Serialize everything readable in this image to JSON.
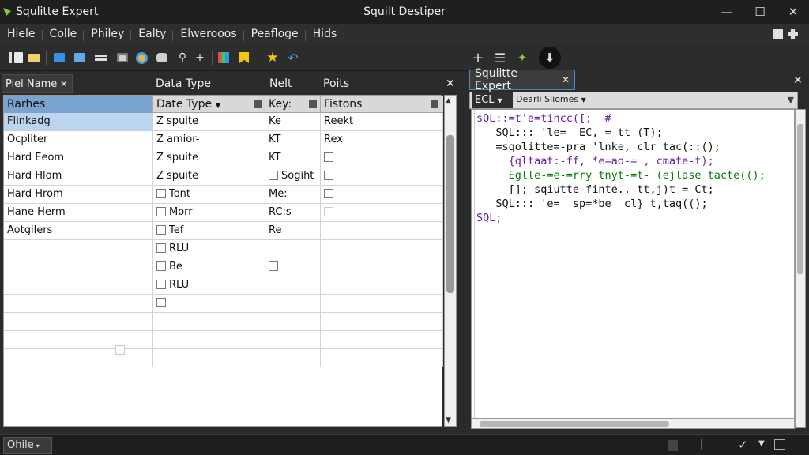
{
  "window": {
    "app_title": "Squlitte Expert",
    "center_title": "Squilt Destiper",
    "minimize": "—",
    "maximize": "☐",
    "close": "✕"
  },
  "menu": [
    "Hiele",
    "Colle",
    "Philey",
    "Ealty",
    "Elwerooos",
    "Peafloge",
    "Hids"
  ],
  "left_panel": {
    "tab_label": "Piel Name",
    "header_columns": [
      "Data Type",
      "Nelt",
      "Poits"
    ],
    "close": "✕",
    "grid": {
      "headers": [
        "Rarhes",
        "Date Type",
        "Key:",
        "Fistons"
      ],
      "rows": [
        {
          "name": "Flinkadg",
          "type": "Z spuite",
          "key": "Ke",
          "pos": "Reekt",
          "type_cb": false,
          "key_cb": false,
          "pos_cb": false
        },
        {
          "name": "Ocpliter",
          "type": "Z amior-",
          "key": "KT",
          "pos": "Rex",
          "type_cb": false,
          "key_cb": false,
          "pos_cb": false
        },
        {
          "name": "Hard Eeom",
          "type": "Z spuite",
          "key": "KT",
          "pos": "",
          "type_cb": false,
          "key_cb": false,
          "pos_cb": true
        },
        {
          "name": "Hard Hlom",
          "type": "Z spuite",
          "key": "Sogiht",
          "pos": "",
          "type_cb": false,
          "key_cb": true,
          "pos_cb": true
        },
        {
          "name": "Hard Hrom",
          "type": "Tont",
          "key": "Me:",
          "pos": "",
          "type_cb": true,
          "key_cb": false,
          "pos_cb": true
        },
        {
          "name": "Hane Herm",
          "type": "Morr",
          "key": "RC:s",
          "pos": "",
          "type_cb": true,
          "key_cb": false,
          "pos_cb": true
        },
        {
          "name": "Aotgilers",
          "type": "Tef",
          "key": "Re",
          "pos": "",
          "type_cb": true,
          "key_cb": false,
          "pos_cb": false
        },
        {
          "name": "",
          "type": "RLU",
          "key": "",
          "pos": "",
          "type_cb": true,
          "key_cb": false,
          "pos_cb": false
        },
        {
          "name": "",
          "type": "Be",
          "key": "",
          "pos": "",
          "type_cb": true,
          "key_cb": true,
          "pos_cb": false
        },
        {
          "name": "",
          "type": "RLU",
          "key": "",
          "pos": "",
          "type_cb": true,
          "key_cb": false,
          "pos_cb": false
        },
        {
          "name": "",
          "type": "",
          "key": "",
          "pos": "",
          "type_cb": true,
          "key_cb": false,
          "pos_cb": false
        },
        {
          "name": "",
          "type": "",
          "key": "",
          "pos": "",
          "type_cb": false,
          "key_cb": false,
          "pos_cb": false
        },
        {
          "name": "",
          "type": "",
          "key": "",
          "pos": "",
          "type_cb": false,
          "key_cb": false,
          "pos_cb": false
        },
        {
          "name": "",
          "type": "",
          "key": "",
          "pos": "",
          "type_cb": false,
          "key_cb": false,
          "pos_cb": false
        }
      ]
    }
  },
  "right_panel": {
    "tab_label": "Squlitte Expert",
    "close": "✕",
    "sub_left": "ECL",
    "sub_dropdown": "Dearli Sliomes",
    "code_lines": [
      "sQL::=t'e=tincc([;  #",
      "   SQL::: 'le=  EC, =-tt (T);",
      "   =sqolitte=-pra 'lnke, clr tac(::();",
      "     {qltaat:-ff, *e=ao-= , cmate-t);",
      "     Eglle-=e-=rry tnyt-=t- (ejlase tacte(();",
      "     []; sqiutte-finte.. tt,j)t = Ct;",
      "   SQL::: 'e=  sp=*be  cl} t,taq(();",
      "SQL;"
    ]
  },
  "status": {
    "left": "Ohile"
  }
}
